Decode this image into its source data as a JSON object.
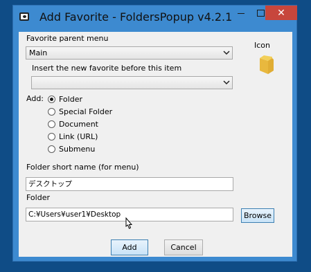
{
  "window": {
    "title": "Add Favorite - FoldersPopup v4.2.1",
    "close_symbol": "✕"
  },
  "form": {
    "parent_menu_label": "Favorite parent menu",
    "parent_menu_value": "Main",
    "insert_before_label": "Insert the new favorite before this item",
    "insert_before_value": "",
    "icon_label": "Icon",
    "add_label": "Add:",
    "radio_options": [
      {
        "label": "Folder",
        "checked": true
      },
      {
        "label": "Special Folder",
        "checked": false
      },
      {
        "label": "Document",
        "checked": false
      },
      {
        "label": "Link (URL)",
        "checked": false
      },
      {
        "label": "Submenu",
        "checked": false
      }
    ],
    "short_name_label": "Folder short name (for menu)",
    "short_name_value": "デスクトップ",
    "folder_label": "Folder",
    "folder_value": "C:¥Users¥user1¥Desktop",
    "browse_label": "Browse"
  },
  "buttons": {
    "add_label": "Add",
    "cancel_label": "Cancel"
  },
  "colors": {
    "desktop": "#0f4c86",
    "titlebar": "#3d8ad0",
    "close": "#c7463c",
    "folder_icon": "#f2cf59"
  },
  "icons": [
    "app-icon",
    "chevron-down-icon",
    "folder-icon",
    "mouse-pointer-icon"
  ]
}
